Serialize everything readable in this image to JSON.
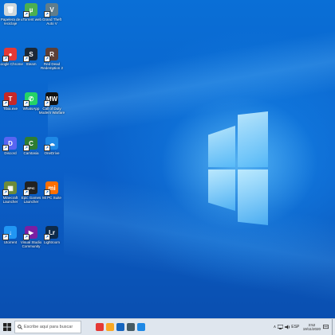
{
  "desktop_icons": [
    {
      "id": "recycle-bin",
      "label": "Papelera de reciclaje",
      "color": "#cfd8dc",
      "glyph": "🗑"
    },
    {
      "id": "utorrent",
      "label": "uTorrent web",
      "color": "#4caf50",
      "glyph": "µ"
    },
    {
      "id": "gta",
      "label": "Grand Theft Auto V",
      "color": "#607d8b",
      "glyph": "V"
    },
    {
      "id": "chrome",
      "label": "Google Chrome",
      "color": "#e53935",
      "glyph": "●"
    },
    {
      "id": "steam",
      "label": "Steam",
      "color": "#1b2838",
      "glyph": "S"
    },
    {
      "id": "red-dead",
      "label": "Red Dead Redemption 2",
      "color": "#5d4037",
      "glyph": "R"
    },
    {
      "id": "game-red",
      "label": "Tibia.exe",
      "color": "#c62828",
      "glyph": "T"
    },
    {
      "id": "whatsapp",
      "label": "WhatsApp",
      "color": "#25d366",
      "glyph": "✆"
    },
    {
      "id": "mw",
      "label": "Call of Duty Modern Warfare",
      "color": "#111111",
      "glyph": "MW"
    },
    {
      "id": "discord",
      "label": "Discord",
      "color": "#5865f2",
      "glyph": "D"
    },
    {
      "id": "camtasia",
      "label": "Camtasia",
      "color": "#2e7d32",
      "glyph": "C"
    },
    {
      "id": "onedrive",
      "label": "OneDrive",
      "color": "#1e88e5",
      "glyph": "☁"
    },
    {
      "id": "minecraft",
      "label": "Minecraft Launcher",
      "color": "#6d8b3a",
      "glyph": "▦"
    },
    {
      "id": "epic",
      "label": "Epic Games Launcher",
      "color": "#222222",
      "glyph": "EPIC"
    },
    {
      "id": "xiaomi",
      "label": "Mi PC Suite",
      "color": "#ff6f00",
      "glyph": "mi"
    },
    {
      "id": "app-blue",
      "label": "Utorrent",
      "color": "#2196f3",
      "glyph": "↓"
    },
    {
      "id": "vs",
      "label": "Visual Studio Community",
      "color": "#7b1fa2",
      "glyph": "▶"
    },
    {
      "id": "app-dark",
      "label": "Lightroom",
      "color": "#0d2a4a",
      "glyph": "Lr"
    }
  ],
  "taskbar": {
    "search_placeholder": "Escribe aquí para buscar",
    "apps": [
      {
        "name": "chrome",
        "color": "#e53935"
      },
      {
        "name": "file-explorer",
        "color": "#f9a825"
      },
      {
        "name": "word",
        "color": "#1565c0"
      },
      {
        "name": "store",
        "color": "#455a64"
      },
      {
        "name": "mail",
        "color": "#1e88e5"
      }
    ],
    "tray": {
      "chevron": "∧",
      "lang": "ESP",
      "time": "3:52",
      "date": "19/11/2020"
    }
  }
}
